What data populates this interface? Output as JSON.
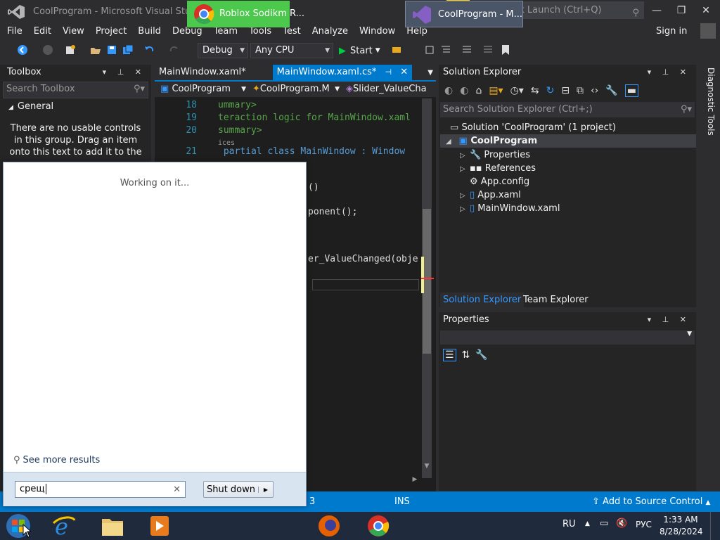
{
  "window": {
    "title": "CoolProgram - Microsoft Visual Studio",
    "quick_launch_placeholder": "Quick Launch (Ctrl+Q)",
    "controls": [
      "—",
      "❐",
      "✕"
    ]
  },
  "menu": [
    "File",
    "Edit",
    "View",
    "Project",
    "Build",
    "Debug",
    "Team",
    "Tools",
    "Test",
    "Analyze",
    "Window",
    "Help"
  ],
  "signin": "Sign in",
  "toolbar": {
    "configuration": "Debug",
    "platform": "Any CPU",
    "start_label": "Start"
  },
  "toolbox": {
    "title": "Toolbox",
    "search_placeholder": "Search Toolbox",
    "group": "General",
    "empty_message": "There are no usable controls in this group. Drag an item onto this text to add it to the"
  },
  "editor": {
    "tabs": [
      {
        "label": "MainWindow.xaml*",
        "active": false
      },
      {
        "label": "MainWindow.xaml.cs*",
        "active": true
      }
    ],
    "nav": [
      "CoolProgram",
      "CoolProgram.M",
      "Slider_ValueCha"
    ],
    "lines": [
      {
        "num": "18",
        "text": "ummary>"
      },
      {
        "num": "19",
        "text": "teraction logic for MainWindow.xaml"
      },
      {
        "num": "20",
        "text": "summary>"
      },
      {
        "num": "",
        "text": "ices"
      },
      {
        "num": "21",
        "text": " partial class MainWindow : Window"
      }
    ],
    "fragments": [
      "()",
      "ponent();",
      "er_ValueChanged(obje"
    ]
  },
  "solution_explorer": {
    "title": "Solution Explorer",
    "search_placeholder": "Search Solution Explorer (Ctrl+;)",
    "solution": "Solution 'CoolProgram' (1 project)",
    "project": "CoolProgram",
    "items": [
      "Properties",
      "References",
      "App.config",
      "App.xaml",
      "MainWindow.xaml"
    ],
    "bottom_tabs": [
      "Solution Explorer",
      "Team Explorer"
    ]
  },
  "diagnostic_tools": "Diagnostic Tools",
  "properties": {
    "title": "Properties"
  },
  "statusbar": {
    "col": "3",
    "ins": "INS",
    "source_control": "Add to Source Control"
  },
  "start_menu": {
    "working": "Working on it...",
    "see_more": "See more results",
    "search_value": "срещ",
    "shutdown": "Shut down"
  },
  "taskbar": {
    "roblox_label": "Roblox Sodikm R...",
    "vs_label": "CoolProgram - M...",
    "lang": "RU",
    "keyboard": "РУС",
    "time": "1:33 AM",
    "date": "8/28/2024"
  },
  "colors": {
    "accent": "#007acc",
    "roblox_task": "#4cc94c"
  }
}
